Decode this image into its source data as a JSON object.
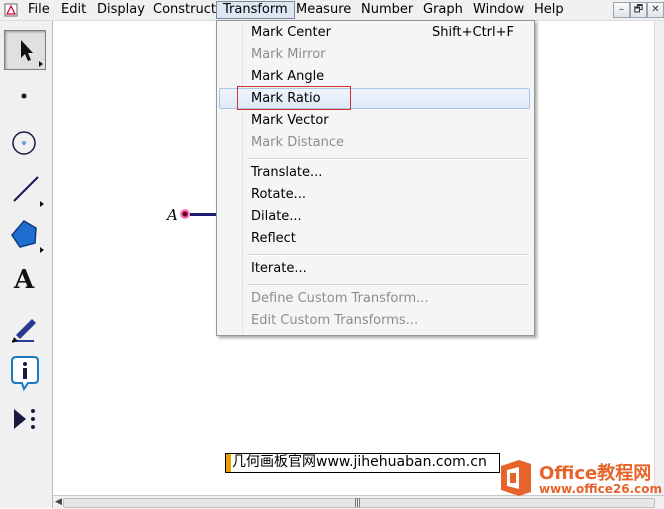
{
  "menubar": {
    "items": [
      {
        "label": "File"
      },
      {
        "label": "Edit"
      },
      {
        "label": "Display"
      },
      {
        "label": "Construct"
      },
      {
        "label": "Transform"
      },
      {
        "label": "Measure"
      },
      {
        "label": "Number"
      },
      {
        "label": "Graph"
      },
      {
        "label": "Window"
      },
      {
        "label": "Help"
      }
    ],
    "open_menu": "Transform",
    "window_buttons": {
      "minimize": "–",
      "restore": "🗗",
      "close": "✕"
    }
  },
  "toolbox": {
    "tools": [
      "arrow-select-tool",
      "point-tool",
      "compass-tool",
      "straightedge-tool",
      "polygon-tool",
      "text-tool",
      "marker-tool",
      "information-tool",
      "custom-tool"
    ],
    "selected": "arrow-select-tool",
    "text_tool_glyph": "A"
  },
  "transform_menu": {
    "items": [
      {
        "label": "Mark Center",
        "shortcut": "Shift+Ctrl+F",
        "enabled": true
      },
      {
        "label": "Mark Mirror",
        "enabled": false
      },
      {
        "label": "Mark Angle",
        "enabled": true
      },
      {
        "label": "Mark Ratio",
        "enabled": true,
        "highlighted": true
      },
      {
        "label": "Mark Vector",
        "enabled": true
      },
      {
        "label": "Mark Distance",
        "enabled": false
      },
      {
        "label": "Translate...",
        "enabled": true
      },
      {
        "label": "Rotate...",
        "enabled": true
      },
      {
        "label": "Dilate...",
        "enabled": true
      },
      {
        "label": "Reflect",
        "enabled": true
      },
      {
        "label": "Iterate...",
        "enabled": true
      },
      {
        "label": "Define Custom Transform...",
        "enabled": false
      },
      {
        "label": "Edit Custom Transforms...",
        "enabled": false
      }
    ]
  },
  "canvas": {
    "point_label": "A",
    "point_color": "#d01080",
    "segment_color": "#1a1a70"
  },
  "watermark": {
    "text": "几何画板官网www.jihehuaban.com.cn"
  },
  "brand": {
    "title": "Office教程网",
    "url": "www.office26.com",
    "color": "#e8622b"
  },
  "scrollbar": {
    "grip": "|||",
    "left_arrow": "◀",
    "right_arrow": "▶"
  }
}
